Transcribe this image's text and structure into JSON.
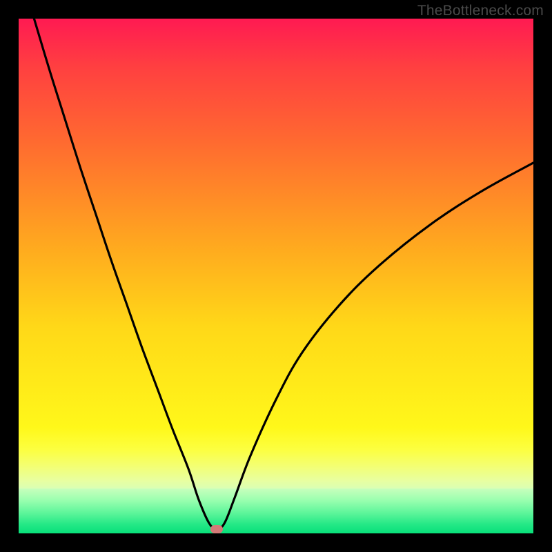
{
  "watermark": "TheBottleneck.com",
  "marker": {
    "x_pct": 38.5,
    "y_pct": 99.2
  },
  "chart_data": {
    "type": "line",
    "title": "",
    "xlabel": "",
    "ylabel": "",
    "xlim": [
      0,
      100
    ],
    "ylim": [
      0,
      100
    ],
    "note": "Bottleneck curve: V-shaped curve where low values (green, bottom) are good and high values (red, top) are bad. Minimum near x≈38.5%.",
    "series": [
      {
        "name": "bottleneck-curve",
        "x": [
          3,
          6,
          9,
          12,
          15,
          18,
          21,
          24,
          27,
          30,
          33,
          35,
          37,
          38.5,
          40,
          42,
          45,
          50,
          55,
          62,
          70,
          80,
          90,
          100
        ],
        "y": [
          100,
          90,
          80.5,
          71,
          62,
          53,
          44.5,
          36,
          28,
          20,
          12.5,
          6.5,
          2,
          0.8,
          2,
          7,
          15,
          26,
          35,
          44,
          52,
          60,
          66.5,
          72
        ]
      }
    ],
    "gradient_stops": [
      {
        "pct": 0,
        "color": "#ff1a52"
      },
      {
        "pct": 40,
        "color": "#ff9020"
      },
      {
        "pct": 70,
        "color": "#fff81a"
      },
      {
        "pct": 92,
        "color": "#d8ffb8"
      },
      {
        "pct": 100,
        "color": "#08e07a"
      }
    ],
    "marker_color": "#d47a78"
  }
}
